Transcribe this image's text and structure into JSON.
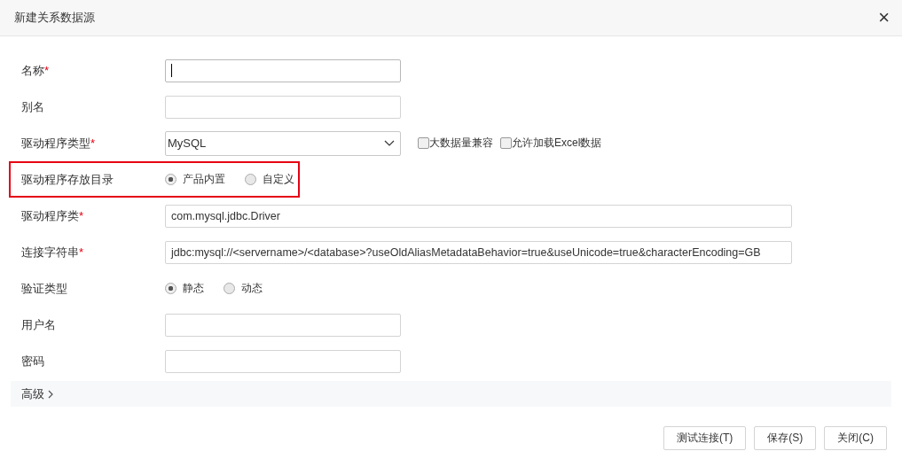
{
  "window": {
    "title": "新建关系数据源",
    "close": "×"
  },
  "fields": [
    {
      "kind": "text",
      "label": "名称",
      "required_mark": "*",
      "focused": true,
      "wide": false,
      "highlighted": false
    },
    {
      "kind": "text",
      "label": "别名",
      "focused": false,
      "wide": false,
      "highlighted": false
    },
    {
      "kind": "select",
      "label": "驱动程序类型",
      "required_mark": "*",
      "value": "MySQL",
      "highlighted": false,
      "checkboxes": [
        {
          "label": "大数据量兼容",
          "checked": false
        },
        {
          "label": "允许加载Excel数据",
          "checked": false
        }
      ]
    },
    {
      "kind": "radio",
      "label": "驱动程序存放目录",
      "highlighted": true,
      "options": [
        {
          "label": "产品内置",
          "selected": true
        },
        {
          "label": "自定义",
          "selected": false
        }
      ]
    },
    {
      "kind": "text",
      "label": "驱动程序类",
      "required_mark": "*",
      "value": "com.mysql.jdbc.Driver",
      "focused": false,
      "wide": true,
      "highlighted": false
    },
    {
      "kind": "text",
      "label": "连接字符串",
      "required_mark": "*",
      "value": "jdbc:mysql://<servername>/<database>?useOldAliasMetadataBehavior=true&useUnicode=true&characterEncoding=GB",
      "focused": false,
      "wide": true,
      "highlighted": false
    },
    {
      "kind": "radio",
      "label": "验证类型",
      "highlighted": false,
      "options": [
        {
          "label": "静态",
          "selected": true
        },
        {
          "label": "动态",
          "selected": false
        }
      ]
    },
    {
      "kind": "text",
      "label": "用户名",
      "focused": false,
      "wide": false,
      "highlighted": false
    },
    {
      "kind": "text",
      "label": "密码",
      "focused": false,
      "wide": false,
      "highlighted": false
    }
  ],
  "advanced": {
    "label": "高级",
    "expanded": false
  },
  "buttons": [
    "测试连接(T)",
    "保存(S)",
    "关闭(C)"
  ]
}
